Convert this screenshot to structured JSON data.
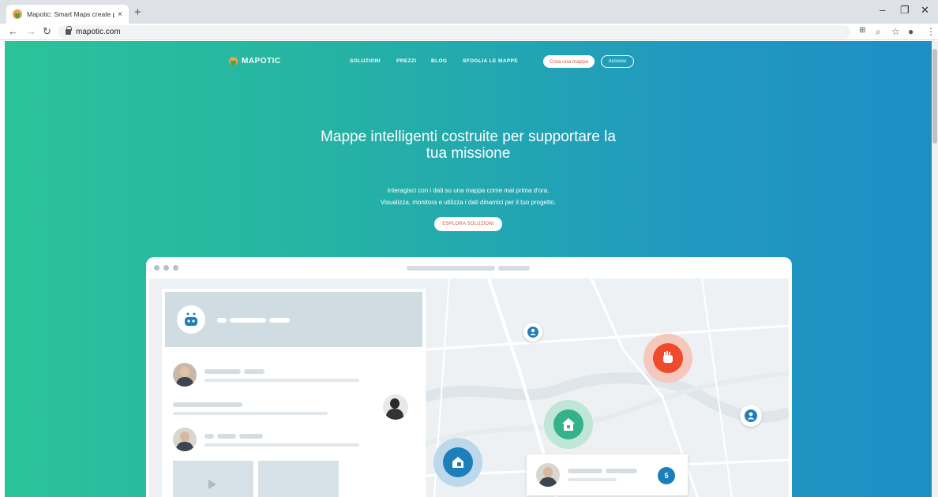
{
  "browser": {
    "tab_title": "Mapotic: Smart Maps create per",
    "tab_close": "×",
    "new_tab": "+",
    "url": "mapotic.com",
    "window_controls": [
      "–",
      "❐",
      "✕"
    ]
  },
  "site": {
    "logo_text": "MAPOTIC",
    "nav": [
      "SOLUZIONI",
      "PREZZI",
      "BLOG",
      "SFOGLIA LE MAPPE"
    ],
    "create_map_label": "Crea una mappa",
    "login_label": "Accesso",
    "hero_title": "Mappe intelligenti costruite per supportare la tua missione",
    "hero_sub_line1": "Interagisci con i dati su una mappa come mai prima d'ora.",
    "hero_sub_line2": "Visualizza, monitora e utilizza i dati dinamici per il tuo progetto.",
    "explore_label": "ESPLORA SOLUZIONI"
  },
  "mockup": {
    "notification_count": "5"
  },
  "colors": {
    "gradient_start": "#2bc39a",
    "gradient_end": "#1e8fc5",
    "accent": "#e4553c",
    "marker_blue": "#1d7fb9",
    "marker_green": "#34b38a"
  }
}
